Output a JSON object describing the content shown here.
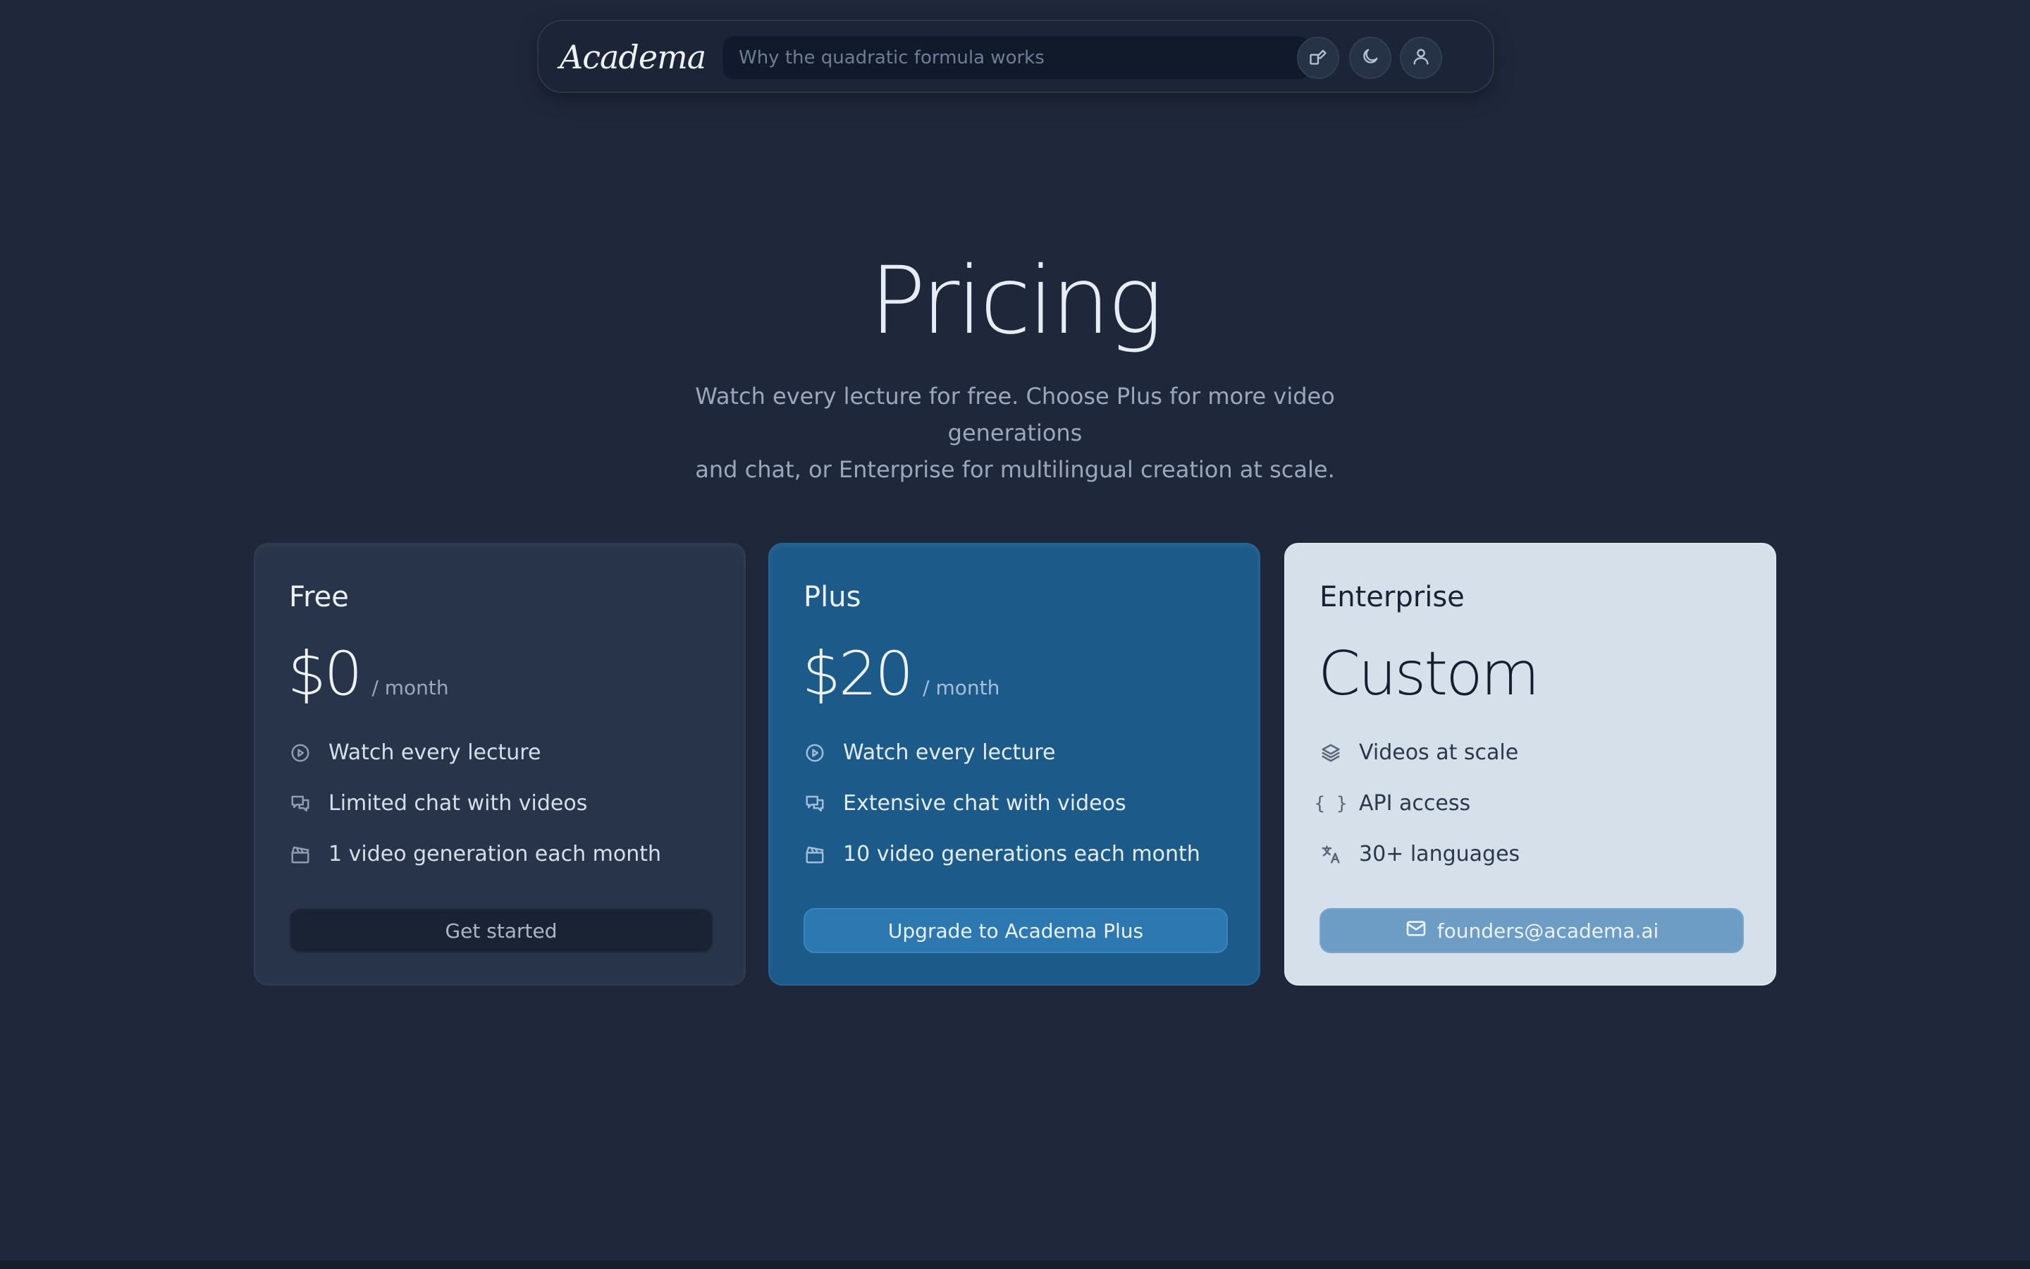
{
  "header": {
    "logo": "Academa",
    "search_placeholder": "Why the quadratic formula works",
    "icons": [
      "shapes-icon",
      "moon-icon",
      "user-icon"
    ]
  },
  "hero": {
    "title": "Pricing",
    "subtitle_line1": "Watch every lecture for free. Choose Plus for more video generations",
    "subtitle_line2": "and chat, or Enterprise for multilingual creation at scale."
  },
  "plans": [
    {
      "name": "Free",
      "price": "$0",
      "period": "/ month",
      "features": [
        {
          "icon": "play-circle-icon",
          "label": "Watch every lecture"
        },
        {
          "icon": "chat-icon",
          "label": "Limited chat with videos"
        },
        {
          "icon": "clapperboard-icon",
          "label": "1 video generation each month"
        }
      ],
      "cta": "Get started"
    },
    {
      "name": "Plus",
      "price": "$20",
      "period": "/ month",
      "features": [
        {
          "icon": "play-circle-icon",
          "label": "Watch every lecture"
        },
        {
          "icon": "chat-icon",
          "label": "Extensive chat with videos"
        },
        {
          "icon": "clapperboard-icon",
          "label": "10 video generations each month"
        }
      ],
      "cta": "Upgrade to Academa Plus"
    },
    {
      "name": "Enterprise",
      "price": "Custom",
      "features": [
        {
          "icon": "layers-icon",
          "label": "Videos at scale"
        },
        {
          "icon": "braces-icon",
          "label": "API access"
        },
        {
          "icon": "translate-icon",
          "label": "30+ languages"
        }
      ],
      "cta": "founders@academa.ai"
    }
  ],
  "colors": {
    "background": "#1f283b",
    "plus_card": "#1c5a8a",
    "enterprise_card": "#d6e0ea",
    "plus_button": "#2d78b0"
  }
}
